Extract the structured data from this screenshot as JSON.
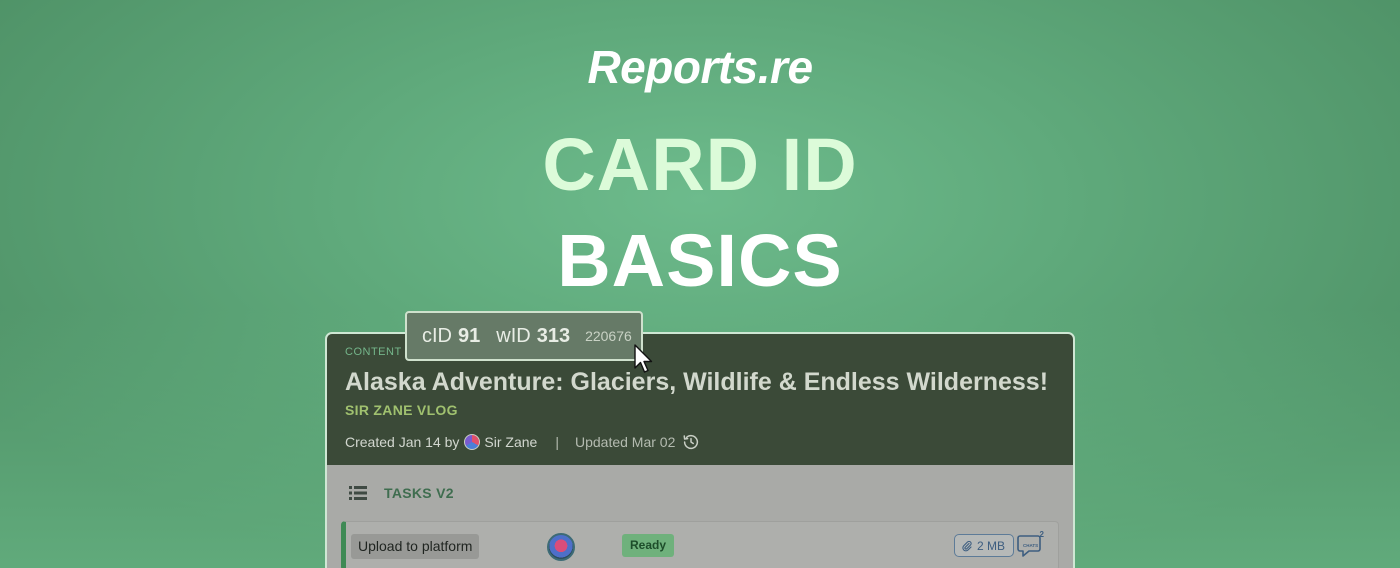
{
  "brand": "Reports.re",
  "headline": {
    "line1": "CARD ID",
    "line2": "BASICS"
  },
  "tooltip": {
    "cid_label": "cID",
    "cid_value": "91",
    "wid_label": "wID",
    "wid_value": "313",
    "number": "220676"
  },
  "card": {
    "kind": "CONTENT",
    "title": "Alaska Adventure: Glaciers, Wildlife & Endless Wilderness!",
    "subtitle": "SIR ZANE VLOG",
    "created_text": "Created Jan 14 by",
    "author": "Sir Zane",
    "separator": "|",
    "updated_text": "Updated Mar 02",
    "icons": {
      "author_avatar": "avatar",
      "history": "history-icon"
    }
  },
  "tasks": {
    "label": "TASKS V2",
    "icon": "list-icon",
    "rows": [
      {
        "name": "Upload to platform",
        "status": "Ready",
        "attachment_size": "2 MB",
        "chat_count": "2",
        "chat_label": "CHATS"
      }
    ]
  },
  "colors": {
    "background": "#5fa97b",
    "card_header": "#3b4a38",
    "subtitle": "#a0c16f",
    "status_ready": "#6fb17c",
    "accent_border": "#3f8a55"
  }
}
